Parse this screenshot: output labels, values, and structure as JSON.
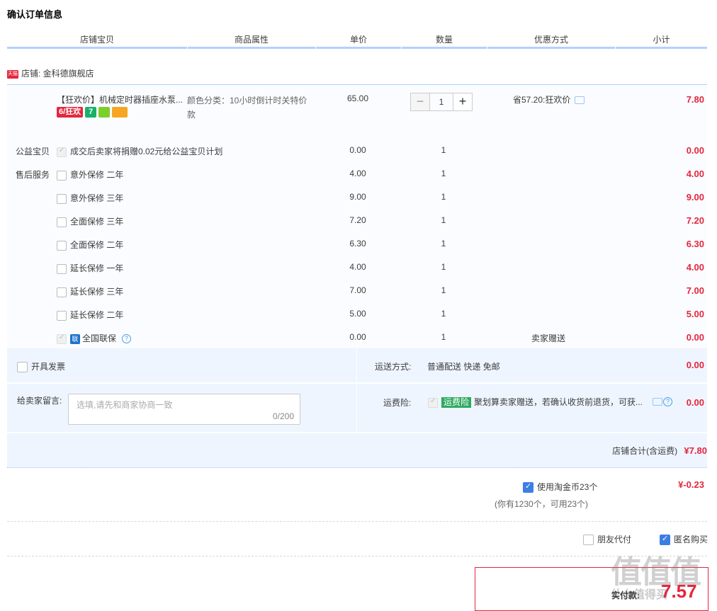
{
  "page_title": "确认订单信息",
  "headers": [
    "店铺宝贝",
    "商品属性",
    "单价",
    "数量",
    "优惠方式",
    "小计"
  ],
  "shop": {
    "badge": "天猫",
    "label": "店铺: 金科德旗舰店"
  },
  "product": {
    "title": "【狂欢价】机械定时器插座水泵...",
    "badge_61": "6/狂欢",
    "badge_7": "7",
    "attr": "颜色分类：10小时倒计时关特价款",
    "price": "65.00",
    "qty": "1",
    "minus": "−",
    "plus": "+",
    "discount": "省57.20:狂欢价",
    "subtotal": "7.80"
  },
  "charity": {
    "label": "公益宝贝",
    "text": "成交后卖家将捐赠0.02元给公益宝贝计划",
    "price": "0.00",
    "qty": "1",
    "subtotal": "0.00"
  },
  "service_label": "售后服务",
  "services": [
    {
      "name": "意外保修 二年",
      "price": "4.00",
      "qty": "1",
      "subtotal": "4.00"
    },
    {
      "name": "意外保修 三年",
      "price": "9.00",
      "qty": "1",
      "subtotal": "9.00"
    },
    {
      "name": "全面保修 三年",
      "price": "7.20",
      "qty": "1",
      "subtotal": "7.20"
    },
    {
      "name": "全面保修 二年",
      "price": "6.30",
      "qty": "1",
      "subtotal": "6.30"
    },
    {
      "name": "延长保修 一年",
      "price": "4.00",
      "qty": "1",
      "subtotal": "4.00"
    },
    {
      "name": "延长保修 三年",
      "price": "7.00",
      "qty": "1",
      "subtotal": "7.00"
    },
    {
      "name": "延长保修 二年",
      "price": "5.00",
      "qty": "1",
      "subtotal": "5.00"
    }
  ],
  "lianbao": {
    "icon": "联",
    "name": "全国联保",
    "price": "0.00",
    "qty": "1",
    "gift": "卖家赠送",
    "subtotal": "0.00",
    "q": "?"
  },
  "invoice": {
    "label": "开具发票"
  },
  "shipping": {
    "label": "运送方式:",
    "value": "普通配送 快递 免邮",
    "amount": "0.00"
  },
  "message": {
    "label": "给卖家留言:",
    "placeholder": "选填,请先和商家协商一致",
    "count": "0/200"
  },
  "insurance": {
    "label": "运费险:",
    "badge": "运费险",
    "text": "聚划算卖家赠送，若确认收货前退货，可获...",
    "amount": "0.00",
    "q": "?"
  },
  "shop_total": {
    "label": "店铺合计(含运费)",
    "amount": "¥7.80"
  },
  "coins": {
    "label": "使用淘金币23个",
    "amount": "¥-0.23",
    "note": "(你有1230个，可用23个)"
  },
  "friend_pay": "朋友代付",
  "anonymous": "匿名购买",
  "pay": {
    "label": "实付款:",
    "amount": "7.57"
  },
  "watermark": {
    "main": "值值值",
    "sub": "什么值得买"
  }
}
